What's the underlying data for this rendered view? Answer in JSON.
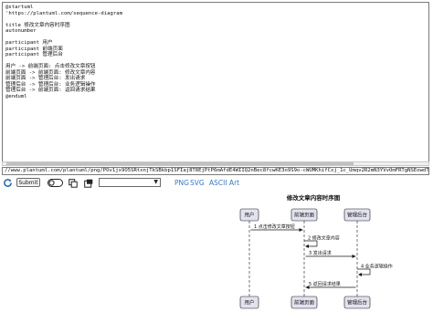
{
  "editor": {
    "lines": [
      "@startuml",
      "'https://plantuml.com/sequence-diagram",
      "",
      "title 修改文章内容时序图",
      "autonumber",
      "",
      "participant 用户",
      "participant 前端页面",
      "participant 管理后台",
      "",
      "用户 -> 前端页面: 点击修改文章按钮",
      "前端页面 -> 前端页面: 修改文章内容",
      "前端页面 -> 管理后台: 发出请求",
      "管理后台 -> 管理后台: 业务逻辑操作",
      "管理后台 -> 前端页面: 返回请求结果",
      "@enduml"
    ]
  },
  "url": "//www.plantuml.com/plantuml/png/POv1jx9O5SRtxnjTkSBkbp1SFIaj8T8EjPtP6mAfdE4WIIQ2nBec8fcwKE3o9S9o-cWUMKhifCxj_1c_Umqv2R2mN3YVvOmFRTgNSEowdTxyoGNWdAe",
  "toolbar": {
    "submit_label": "Submit",
    "select_value": "",
    "formats": [
      "PNG",
      "SVG",
      "ASCII Art"
    ]
  },
  "diagram": {
    "title": "修改文章内容时序图",
    "participants": [
      "用户",
      "前端页面",
      "管理后台"
    ],
    "messages": [
      {
        "num": "1",
        "text": "点击修改文章按钮",
        "from": 0,
        "to": 1
      },
      {
        "num": "2",
        "text": "修改文章内容",
        "from": 1,
        "to": 1
      },
      {
        "num": "3",
        "text": "发出请求",
        "from": 1,
        "to": 2
      },
      {
        "num": "4",
        "text": "业务逻辑操作",
        "from": 2,
        "to": 2
      },
      {
        "num": "5",
        "text": "返回请求结果",
        "from": 2,
        "to": 1
      }
    ],
    "colors": {
      "participant_fill": "#e2e2f0",
      "participant_border": "#181818",
      "lifeline": "#181818",
      "arrow": "#181818"
    }
  }
}
